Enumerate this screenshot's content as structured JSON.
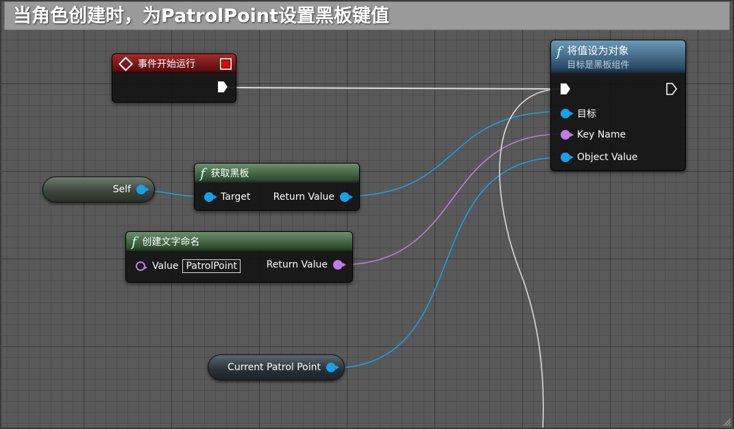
{
  "comment": {
    "title": "当角色创建时，为PatrolPoint设置黑板键值"
  },
  "nodes": {
    "event_begin_play": {
      "title": "事件开始运行"
    },
    "set_value_as_object": {
      "title": "将值设为对象",
      "subtitle": "目标是黑板组件",
      "pins": {
        "target": "目标",
        "key_name": "Key Name",
        "object_value": "Object Value"
      }
    },
    "get_blackboard": {
      "title": "获取黑板",
      "pins": {
        "target": "Target",
        "return_value": "Return Value"
      }
    },
    "make_literal_name": {
      "title": "创建文字命名",
      "pins": {
        "value": "Value",
        "value_field": "PatrolPoint",
        "return_value": "Return Value"
      }
    },
    "self_ref": {
      "label": "Self"
    },
    "current_patrol_point": {
      "label": "Current Patrol Point"
    }
  },
  "colors": {
    "object_pin": "#17a2e8",
    "name_pin": "#c07be8",
    "exec_wire": "#ffffff",
    "event_header": "#a52a2a",
    "func_header_green": "#2e4a2e",
    "func_header_blue": "#2a4a66"
  },
  "icons": {
    "event": "diamond-icon",
    "function": "function-f-icon",
    "delegate": "delegate-square-icon"
  }
}
